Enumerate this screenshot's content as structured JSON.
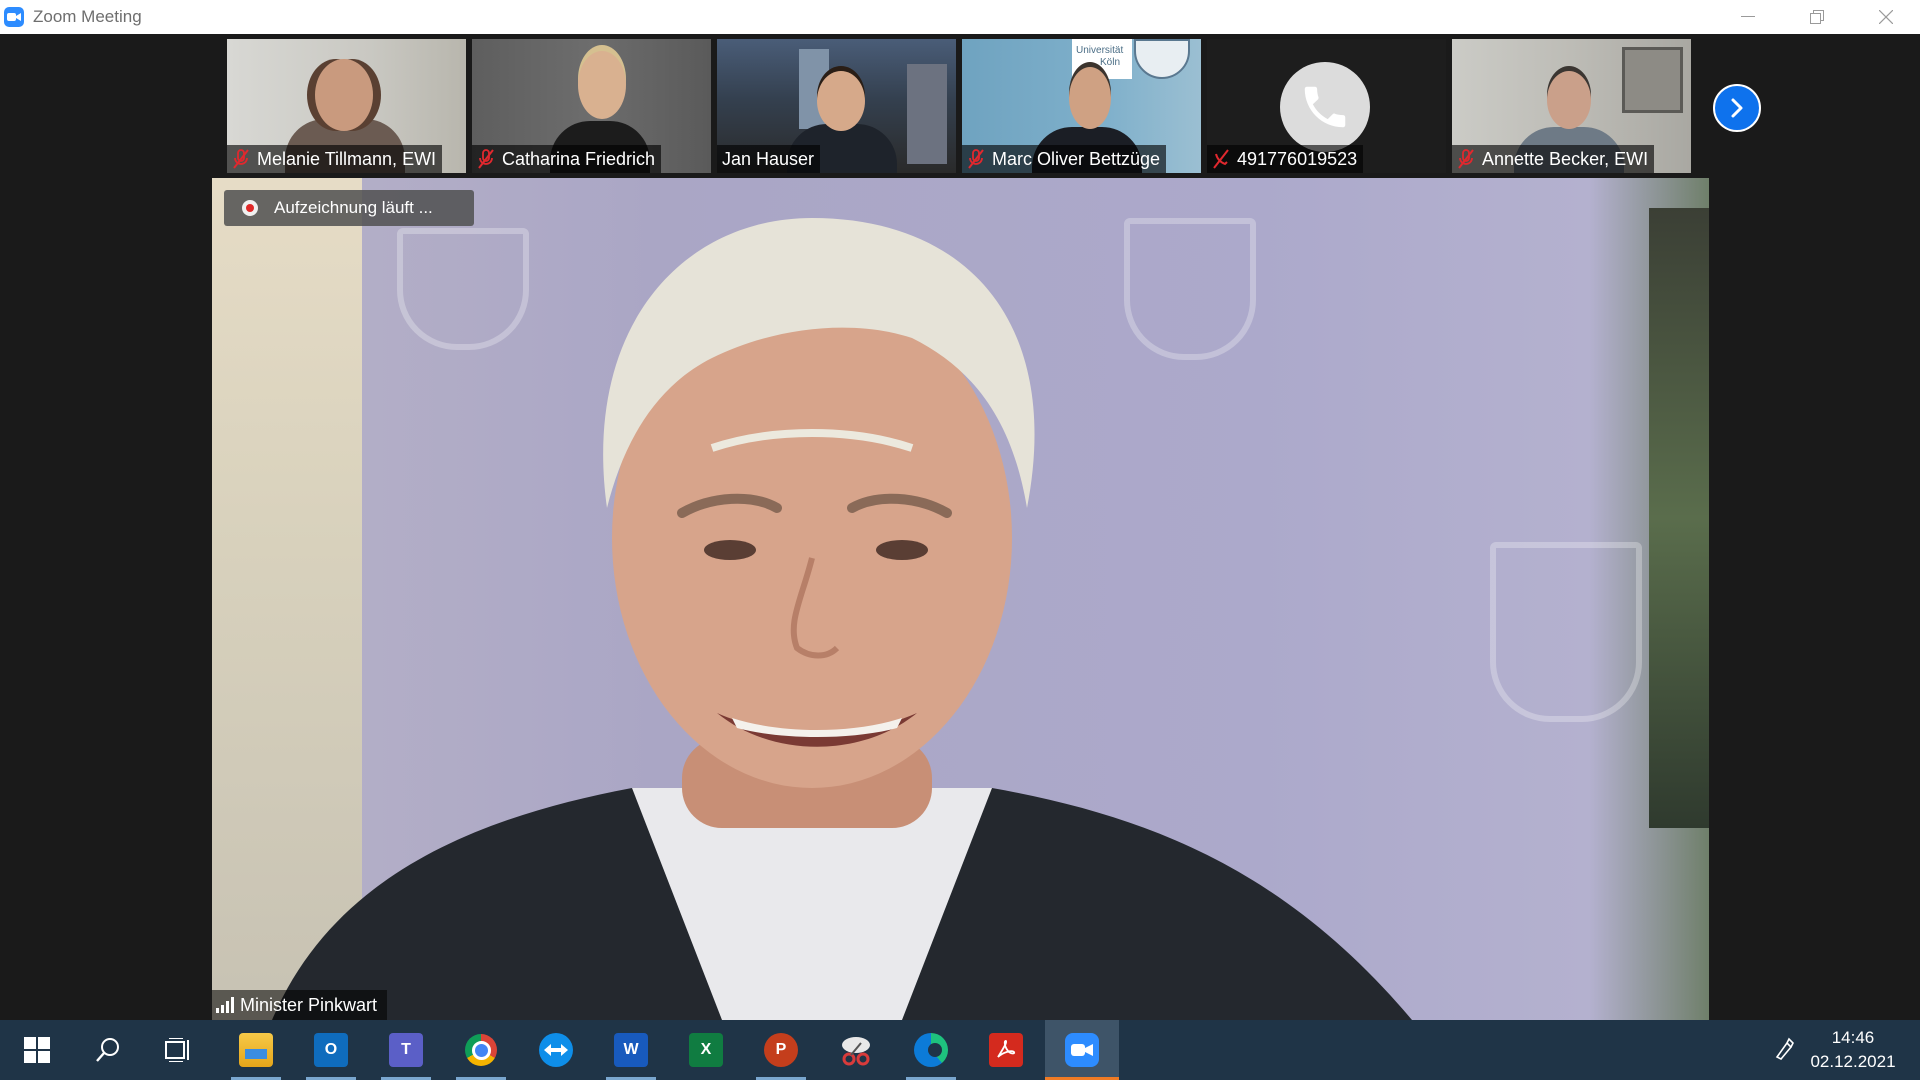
{
  "window": {
    "title": "Zoom Meeting"
  },
  "gallery": {
    "participants": [
      {
        "name": "Melanie Tillmann, EWI",
        "muted": true
      },
      {
        "name": "Catharina Friedrich",
        "muted": true
      },
      {
        "name": "Jan Hauser",
        "muted": false
      },
      {
        "name": "Marc Oliver Bettzüge",
        "muted": true
      },
      {
        "name": "491776019523",
        "muted": true,
        "phone": true
      },
      {
        "name": "Annette Becker, EWI",
        "muted": true
      }
    ],
    "next_icon": "chevron-right-icon",
    "tile_text": {
      "universitaet": "Universität",
      "koeln": "Köln"
    }
  },
  "main": {
    "recording_label": "Aufzeichnung läuft ...",
    "speaker_name": "Minister Pinkwart"
  },
  "taskbar": {
    "apps": [
      "start",
      "search",
      "task-view",
      "file-explorer",
      "outlook",
      "teams",
      "chrome",
      "teamviewer",
      "word",
      "excel",
      "powerpoint",
      "snipping-tool",
      "edge",
      "acrobat",
      "zoom"
    ],
    "time": "14:46",
    "date": "02.12.2021"
  },
  "colors": {
    "accent": "#2d8cff",
    "next_button": "#0e72ed",
    "muted_red": "#e0282e",
    "taskbar": "#1f3447"
  }
}
